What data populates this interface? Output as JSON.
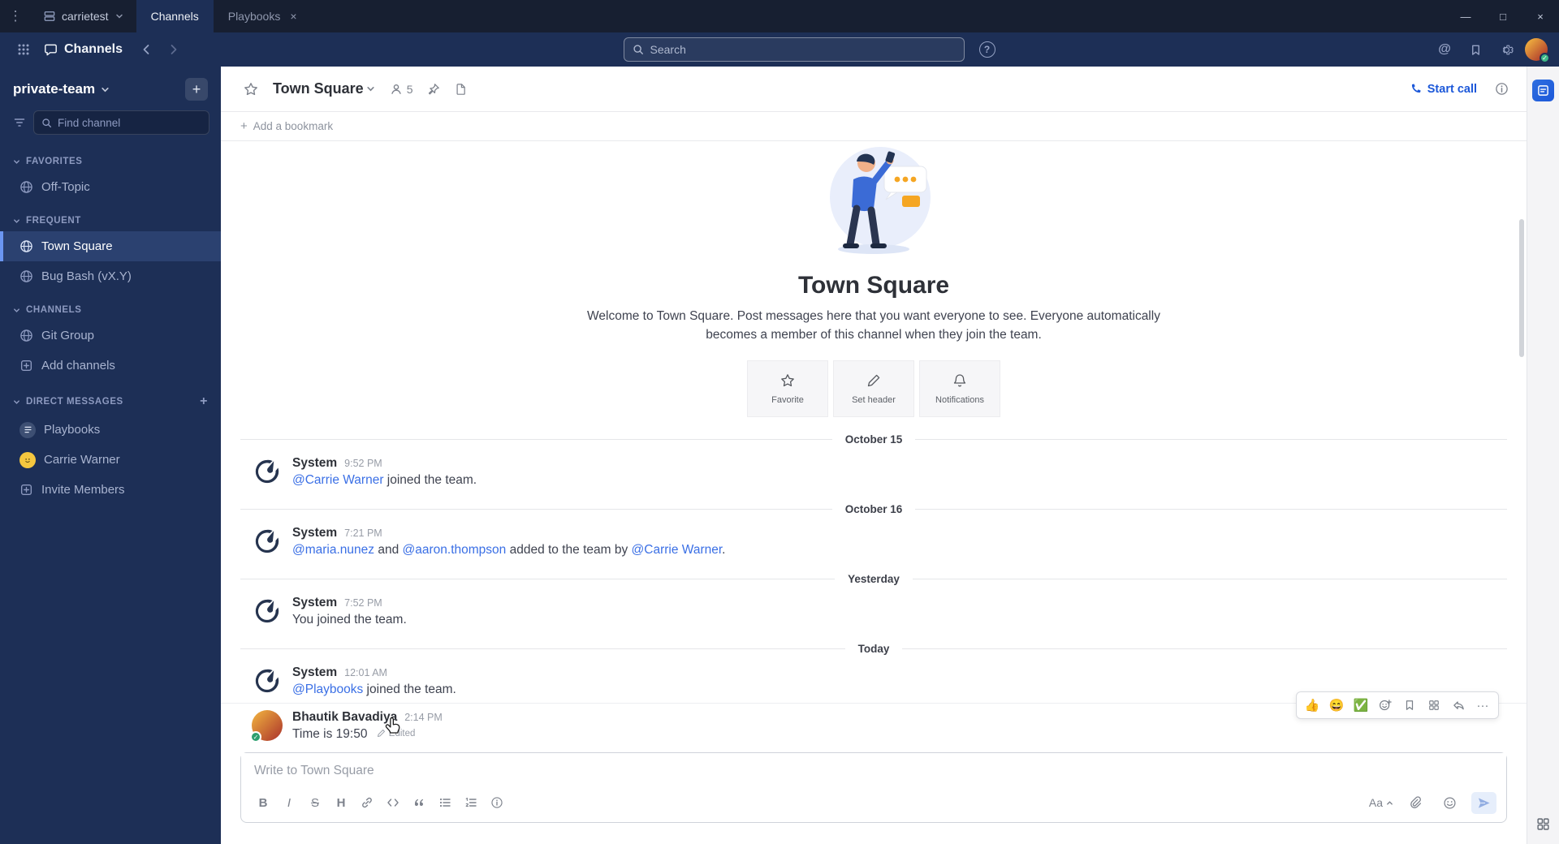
{
  "window": {
    "server_name": "carrietest",
    "tabs": [
      {
        "label": "Channels"
      },
      {
        "label": "Playbooks"
      }
    ],
    "controls": {
      "minimize": "—",
      "maximize": "□",
      "close": "×"
    },
    "menu_dots": "⋮",
    "tab_close": "×"
  },
  "header": {
    "product": "Channels",
    "search_placeholder": "Search",
    "at_sign": "@",
    "help": "?"
  },
  "sidebar": {
    "team": "private-team",
    "add_plus": "+",
    "find_placeholder": "Find channel",
    "sections": [
      {
        "label": "FAVORITES",
        "items": [
          {
            "label": "Off-Topic"
          }
        ]
      },
      {
        "label": "FREQUENT",
        "items": [
          {
            "label": "Town Square"
          },
          {
            "label": "Bug Bash (vX.Y)"
          }
        ]
      },
      {
        "label": "CHANNELS",
        "items": [
          {
            "label": "Git Group"
          },
          {
            "label": "Add channels"
          }
        ]
      },
      {
        "label": "DIRECT MESSAGES",
        "items": [
          {
            "label": "Playbooks"
          },
          {
            "label": "Carrie Warner"
          },
          {
            "label": "Invite Members"
          }
        ]
      }
    ]
  },
  "channel": {
    "name": "Town Square",
    "member_count": "5",
    "start_call": "Start call",
    "add_bookmark": "Add a bookmark",
    "bookmark_plus": "+"
  },
  "intro": {
    "title": "Town Square",
    "description": "Welcome to Town Square. Post messages here that you want everyone to see. Everyone automatically becomes a member of this channel when they join the team.",
    "actions": [
      {
        "label": "Favorite"
      },
      {
        "label": "Set header"
      },
      {
        "label": "Notifications"
      }
    ]
  },
  "timeline": [
    {
      "type": "divider",
      "label": "October 15"
    },
    {
      "type": "system",
      "author": "System",
      "time": "9:52 PM",
      "parts": [
        {
          "t": "link",
          "v": "@Carrie Warner"
        },
        {
          "t": "text",
          "v": " joined the team."
        }
      ]
    },
    {
      "type": "divider",
      "label": "October 16"
    },
    {
      "type": "system",
      "author": "System",
      "time": "7:21 PM",
      "parts": [
        {
          "t": "link",
          "v": "@maria.nunez"
        },
        {
          "t": "text",
          "v": " and "
        },
        {
          "t": "link",
          "v": "@aaron.thompson"
        },
        {
          "t": "text",
          "v": " added to the team by "
        },
        {
          "t": "link",
          "v": "@Carrie Warner"
        },
        {
          "t": "text",
          "v": "."
        }
      ]
    },
    {
      "type": "divider",
      "label": "Yesterday"
    },
    {
      "type": "system",
      "author": "System",
      "time": "7:52 PM",
      "parts": [
        {
          "t": "text",
          "v": "You joined the team."
        }
      ]
    },
    {
      "type": "divider",
      "label": "Today"
    },
    {
      "type": "system",
      "author": "System",
      "time": "12:01 AM",
      "parts": [
        {
          "t": "link",
          "v": "@Playbooks"
        },
        {
          "t": "text",
          "v": " joined the team."
        }
      ]
    },
    {
      "type": "user",
      "author": "Bhautik Bavadiya",
      "time": "2:14 PM",
      "text": "Time is 19:50",
      "edited": "Edited"
    }
  ],
  "hover_toolbar": {
    "reactions": [
      "👍",
      "😄",
      "✅"
    ],
    "more": "···"
  },
  "composer": {
    "placeholder": "Write to Town Square",
    "bold": "B",
    "italic": "I",
    "strike": "S",
    "heading": "H",
    "aa": "Aa"
  },
  "colors": {
    "accent_blue": "#1c58d9",
    "link_blue": "#3a6fe5",
    "sidebar_bg": "#1d2f56",
    "titlebar_bg": "#171f31",
    "online_green": "#3db887"
  }
}
